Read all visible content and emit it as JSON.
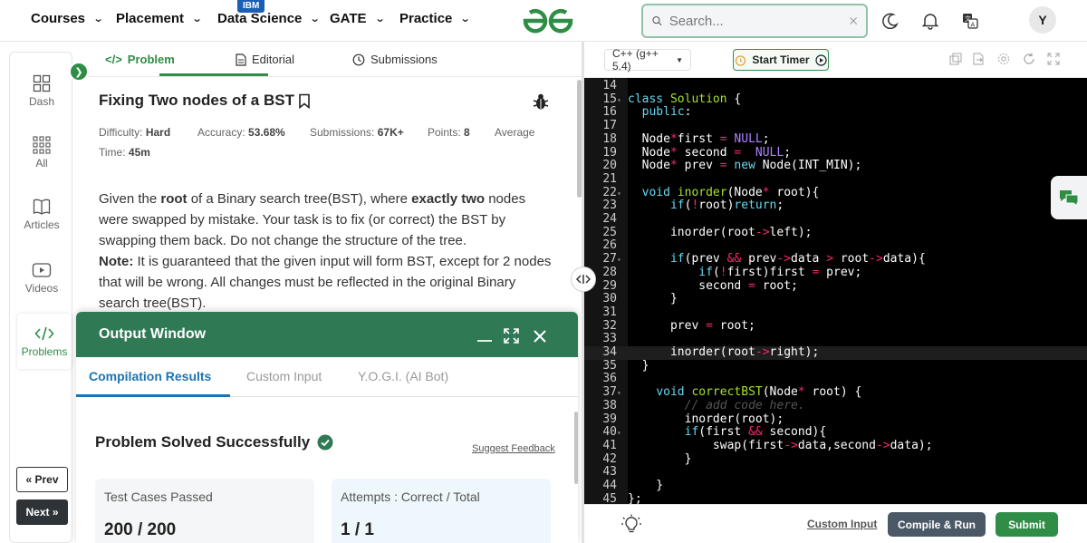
{
  "nav": {
    "items": [
      {
        "label": "Courses"
      },
      {
        "label": "Placement"
      },
      {
        "label": "Data Science"
      },
      {
        "label": "GATE"
      },
      {
        "label": "Practice"
      }
    ],
    "ibm_badge": "IBM",
    "search_placeholder": "Search...",
    "avatar_initial": "Y",
    "brand_color": "#2f8d46"
  },
  "sidebar": {
    "items": [
      {
        "label": "Dash",
        "icon": "dashboard-icon"
      },
      {
        "label": "All",
        "icon": "grid-icon"
      },
      {
        "label": "Articles",
        "icon": "book-icon"
      },
      {
        "label": "Videos",
        "icon": "video-icon"
      },
      {
        "label": "Problems",
        "icon": "code-icon"
      }
    ],
    "prev_label": "Prev",
    "next_label": "Next"
  },
  "problem": {
    "tabs": [
      {
        "label": "Problem"
      },
      {
        "label": "Editorial"
      },
      {
        "label": "Submissions"
      }
    ],
    "title": "Fixing Two nodes of a BST",
    "difficulty_label": "Difficulty:",
    "difficulty": "Hard",
    "accuracy_label": "Accuracy:",
    "accuracy": "53.68%",
    "submissions_label": "Submissions:",
    "submissions": "67K+",
    "points_label": "Points:",
    "points": "8",
    "avg_label": "Average",
    "time_label": "Time:",
    "time": "45m",
    "desc": {
      "p1_a": "Given the ",
      "p1_b": "root",
      "p1_c": " of a Binary search tree(BST), where ",
      "p1_d": "exactly two",
      "p1_e": " nodes were swapped by mistake. Your task is to fix (or correct) the BST by swapping them back. Do not change the structure of the tree.",
      "note_label": "Note:",
      "note_text": " It is guaranteed that the given input will form BST, except for 2 nodes that will be wrong. All changes must be reflected in the original Binary search tree(BST)."
    }
  },
  "output": {
    "title": "Output Window",
    "tabs": [
      {
        "label": "Compilation Results"
      },
      {
        "label": "Custom Input"
      },
      {
        "label": "Y.O.G.I. (AI Bot)"
      }
    ],
    "status": "Problem Solved Successfully",
    "suggest": "Suggest Feedback",
    "cards": [
      {
        "label": "Test Cases Passed",
        "value": "200 / 200"
      },
      {
        "label": "Attempts : Correct / Total",
        "value": "1 / 1"
      }
    ]
  },
  "editor": {
    "language": "C++ (g++ 5.4)",
    "timer_label": "Start Timer",
    "custom_input": "Custom Input",
    "compile_label": "Compile & Run",
    "submit_label": "Submit"
  }
}
